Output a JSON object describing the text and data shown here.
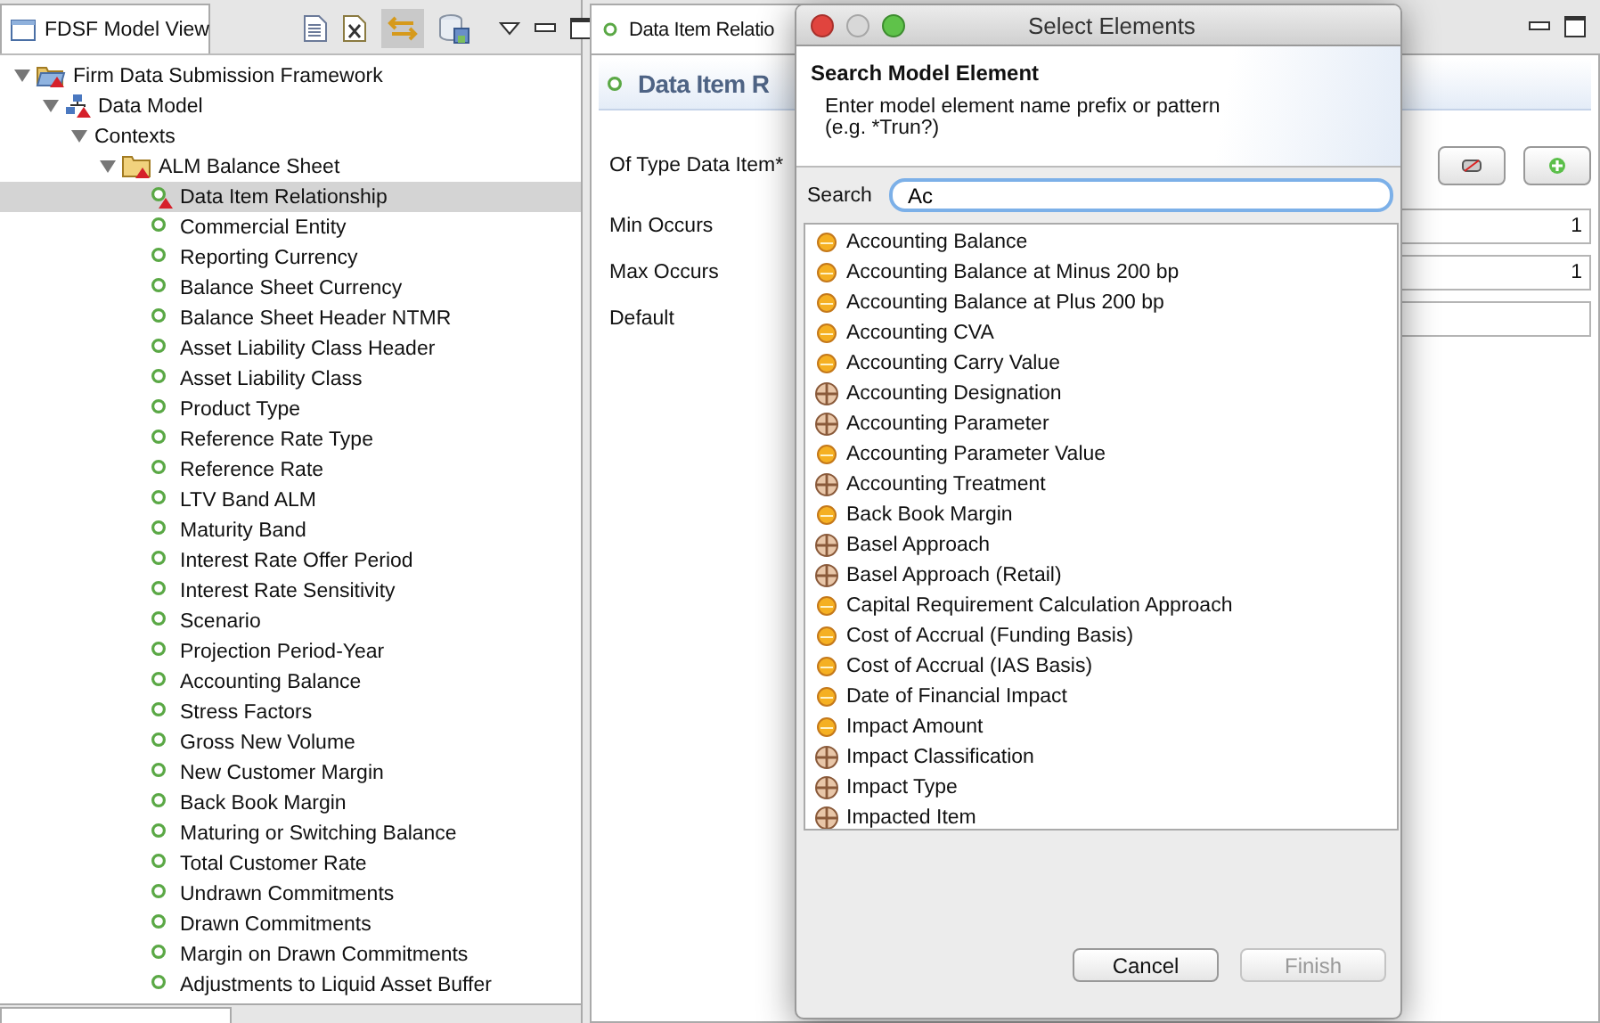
{
  "left_panel": {
    "tab": "FDSF Model View"
  },
  "tree": [
    {
      "label": "Firm Data Submission Framework",
      "kind": "project",
      "error": true,
      "expanded": true,
      "selected": false,
      "children": [
        {
          "label": "Data Model",
          "kind": "model",
          "error": true,
          "expanded": true,
          "selected": false,
          "children": [
            {
              "label": "Contexts",
              "expanded": true,
              "selected": false,
              "children": [
                {
                  "label": "ALM Balance Sheet",
                  "kind": "folder",
                  "error": true,
                  "expanded": true,
                  "selected": false,
                  "children": [
                    {
                      "label": "Data Item Relationship",
                      "kind": "element",
                      "error": true,
                      "selected": true
                    },
                    {
                      "label": "Commercial Entity",
                      "kind": "element",
                      "error": false,
                      "selected": false
                    },
                    {
                      "label": "Reporting Currency",
                      "kind": "element",
                      "error": false,
                      "selected": false
                    },
                    {
                      "label": "Balance Sheet Currency",
                      "kind": "element",
                      "error": false,
                      "selected": false
                    },
                    {
                      "label": "Balance Sheet Header NTMR",
                      "kind": "element",
                      "error": false,
                      "selected": false
                    },
                    {
                      "label": "Asset Liability Class Header",
                      "kind": "element",
                      "error": false,
                      "selected": false
                    },
                    {
                      "label": "Asset Liability Class",
                      "kind": "element",
                      "error": false,
                      "selected": false
                    },
                    {
                      "label": "Product Type",
                      "kind": "element",
                      "error": false,
                      "selected": false
                    },
                    {
                      "label": "Reference Rate Type",
                      "kind": "element",
                      "error": false,
                      "selected": false
                    },
                    {
                      "label": "Reference Rate",
                      "kind": "element",
                      "error": false,
                      "selected": false
                    },
                    {
                      "label": "LTV Band ALM",
                      "kind": "element",
                      "error": false,
                      "selected": false
                    },
                    {
                      "label": "Maturity Band",
                      "kind": "element",
                      "error": false,
                      "selected": false
                    },
                    {
                      "label": "Interest Rate Offer Period",
                      "kind": "element",
                      "error": false,
                      "selected": false
                    },
                    {
                      "label": "Interest Rate Sensitivity",
                      "kind": "element",
                      "error": false,
                      "selected": false
                    },
                    {
                      "label": "Scenario",
                      "kind": "element",
                      "error": false,
                      "selected": false
                    },
                    {
                      "label": "Projection Period-Year",
                      "kind": "element",
                      "error": false,
                      "selected": false
                    },
                    {
                      "label": "Accounting Balance",
                      "kind": "element",
                      "error": false,
                      "selected": false
                    },
                    {
                      "label": "Stress Factors",
                      "kind": "element",
                      "error": false,
                      "selected": false
                    },
                    {
                      "label": "Gross New Volume",
                      "kind": "element",
                      "error": false,
                      "selected": false
                    },
                    {
                      "label": "New Customer Margin",
                      "kind": "element",
                      "error": false,
                      "selected": false
                    },
                    {
                      "label": "Back Book Margin",
                      "kind": "element",
                      "error": false,
                      "selected": false
                    },
                    {
                      "label": "Maturing or Switching Balance",
                      "kind": "element",
                      "error": false,
                      "selected": false
                    },
                    {
                      "label": "Total Customer Rate",
                      "kind": "element",
                      "error": false,
                      "selected": false
                    },
                    {
                      "label": "Undrawn Commitments",
                      "kind": "element",
                      "error": false,
                      "selected": false
                    },
                    {
                      "label": "Drawn Commitments",
                      "kind": "element",
                      "error": false,
                      "selected": false
                    },
                    {
                      "label": "Margin on Drawn Commitments",
                      "kind": "element",
                      "error": false,
                      "selected": false
                    },
                    {
                      "label": "Adjustments to Liquid Asset Buffer",
                      "kind": "element",
                      "error": false,
                      "selected": false
                    }
                  ]
                }
              ]
            }
          ]
        }
      ]
    }
  ],
  "editor": {
    "tab": "Data Item Relatio",
    "header": "Data Item R",
    "fields": [
      {
        "label": "Of Type Data Item*",
        "kind": "buttons"
      },
      {
        "label": "Min Occurs",
        "kind": "text",
        "value": "1"
      },
      {
        "label": "Max Occurs",
        "kind": "text",
        "value": "1"
      },
      {
        "label": "Default",
        "kind": "text"
      }
    ]
  },
  "dialog": {
    "title": "Select Elements",
    "heading": "Search Model Element",
    "description": "Enter model element name prefix or pattern",
    "example": "(e.g. *Trun?)",
    "search_label": "Search",
    "search_value": "Ac",
    "results": [
      {
        "label": "Accounting Balance",
        "kind": "attribute"
      },
      {
        "label": "Accounting Balance at Minus 200 bp",
        "kind": "attribute"
      },
      {
        "label": "Accounting Balance at Plus 200 bp",
        "kind": "attribute"
      },
      {
        "label": "Accounting CVA",
        "kind": "attribute"
      },
      {
        "label": "Accounting Carry Value",
        "kind": "attribute"
      },
      {
        "label": "Accounting Designation",
        "kind": "entity"
      },
      {
        "label": "Accounting Parameter",
        "kind": "entity"
      },
      {
        "label": "Accounting Parameter Value",
        "kind": "attribute"
      },
      {
        "label": "Accounting Treatment",
        "kind": "entity"
      },
      {
        "label": "Back Book Margin",
        "kind": "attribute"
      },
      {
        "label": "Basel Approach",
        "kind": "entity"
      },
      {
        "label": "Basel Approach (Retail)",
        "kind": "entity"
      },
      {
        "label": "Capital Requirement Calculation Approach",
        "kind": "attribute"
      },
      {
        "label": "Cost of Accrual (Funding Basis)",
        "kind": "attribute"
      },
      {
        "label": "Cost of Accrual (IAS Basis)",
        "kind": "attribute"
      },
      {
        "label": "Date of Financial Impact",
        "kind": "attribute"
      },
      {
        "label": "Impact Amount",
        "kind": "attribute"
      },
      {
        "label": "Impact Classification",
        "kind": "entity"
      },
      {
        "label": "Impact Type",
        "kind": "entity"
      },
      {
        "label": "Impacted Item",
        "kind": "entity"
      }
    ],
    "buttons": [
      {
        "label": "Cancel",
        "disabled": false
      },
      {
        "label": "Finish",
        "disabled": true
      }
    ]
  }
}
